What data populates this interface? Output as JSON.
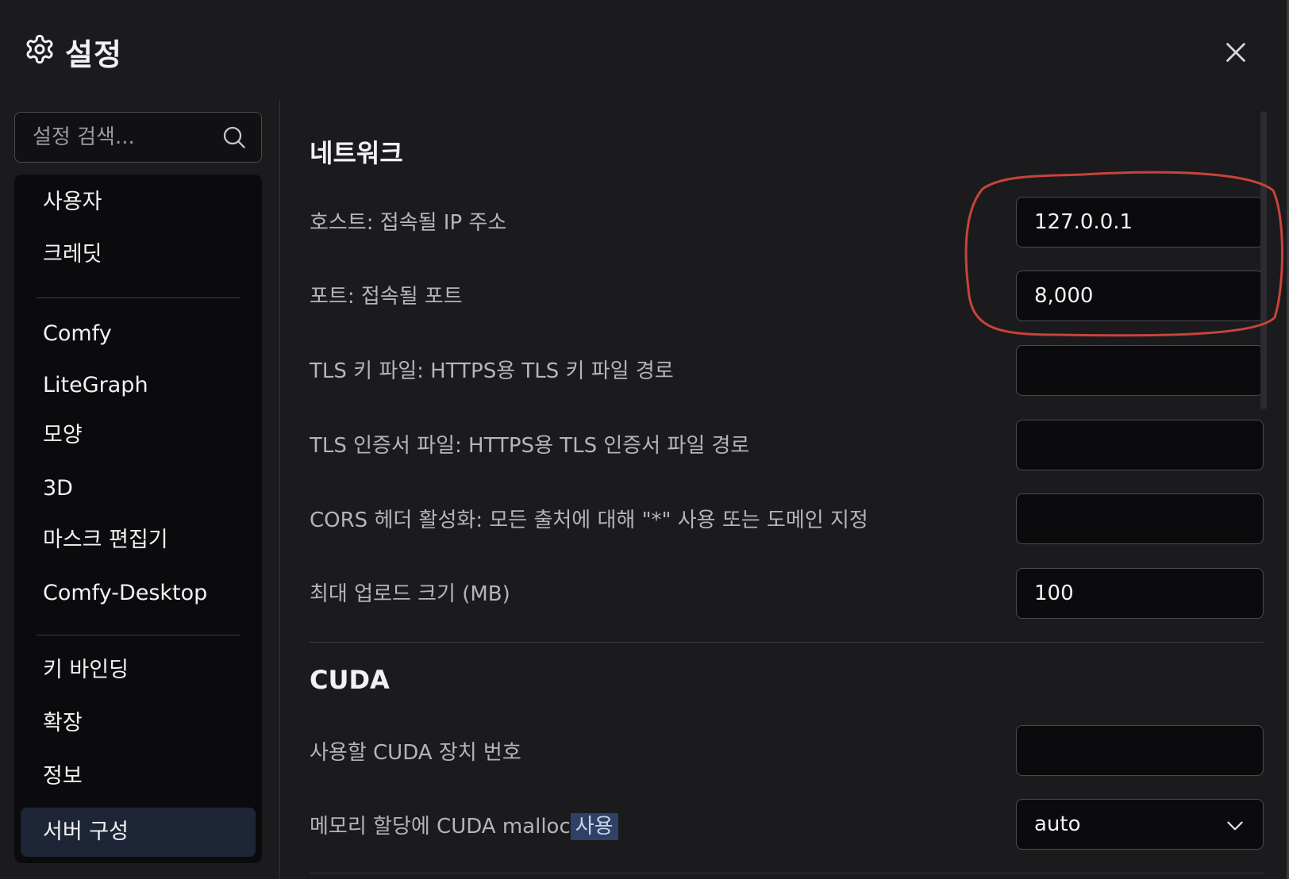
{
  "dialog": {
    "title": "설정",
    "icon": "gear-icon",
    "close_icon": "close-icon"
  },
  "search": {
    "placeholder": "설정 검색...",
    "value": "",
    "icon": "search-icon"
  },
  "sidebar": {
    "groups": [
      [
        "사용자",
        "크레딧"
      ],
      [
        "Comfy",
        "LiteGraph",
        "모양",
        "3D",
        "마스크 편집기",
        "Comfy-Desktop"
      ],
      [
        "키 바인딩",
        "확장",
        "정보",
        "서버 구성"
      ]
    ],
    "active": "서버 구성"
  },
  "sections": {
    "network": {
      "title": "네트워크",
      "rows": [
        {
          "label": "호스트: 접속될 IP 주소",
          "value": ""
        },
        {
          "label": "포트: 접속될 포트",
          "value": ""
        },
        {
          "label": "TLS 키 파일: HTTPS용 TLS 키 파일 경로",
          "value": ""
        },
        {
          "label": "TLS 인증서 파일: HTTPS용 TLS 인증서 파일 경로",
          "value": ""
        },
        {
          "label": "CORS 헤더 활성화: 모든 출처에 대해 \"*\" 사용 또는 도메인 지정",
          "value": ""
        },
        {
          "label": "최대 업로드 크기 (MB)",
          "value": ""
        }
      ]
    },
    "cuda": {
      "title": "CUDA",
      "rows": [
        {
          "label": "사용할 CUDA 장치 번호",
          "value": ""
        },
        {
          "label_main": "메모리 할당에 CUDA malloc",
          "label_highlight": "사용",
          "value": "auto"
        }
      ]
    }
  },
  "fields": {
    "host": "127.0.0.1",
    "port": "8,000",
    "tls_key": "",
    "tls_cert": "",
    "cors": "",
    "max_upload": "100",
    "cuda_device": "",
    "cuda_malloc": "auto"
  },
  "colors": {
    "background": "#1b1b1d",
    "sidebar": "#0b0b0d",
    "active_item": "#1e2536",
    "annotation": "#c8433d"
  }
}
